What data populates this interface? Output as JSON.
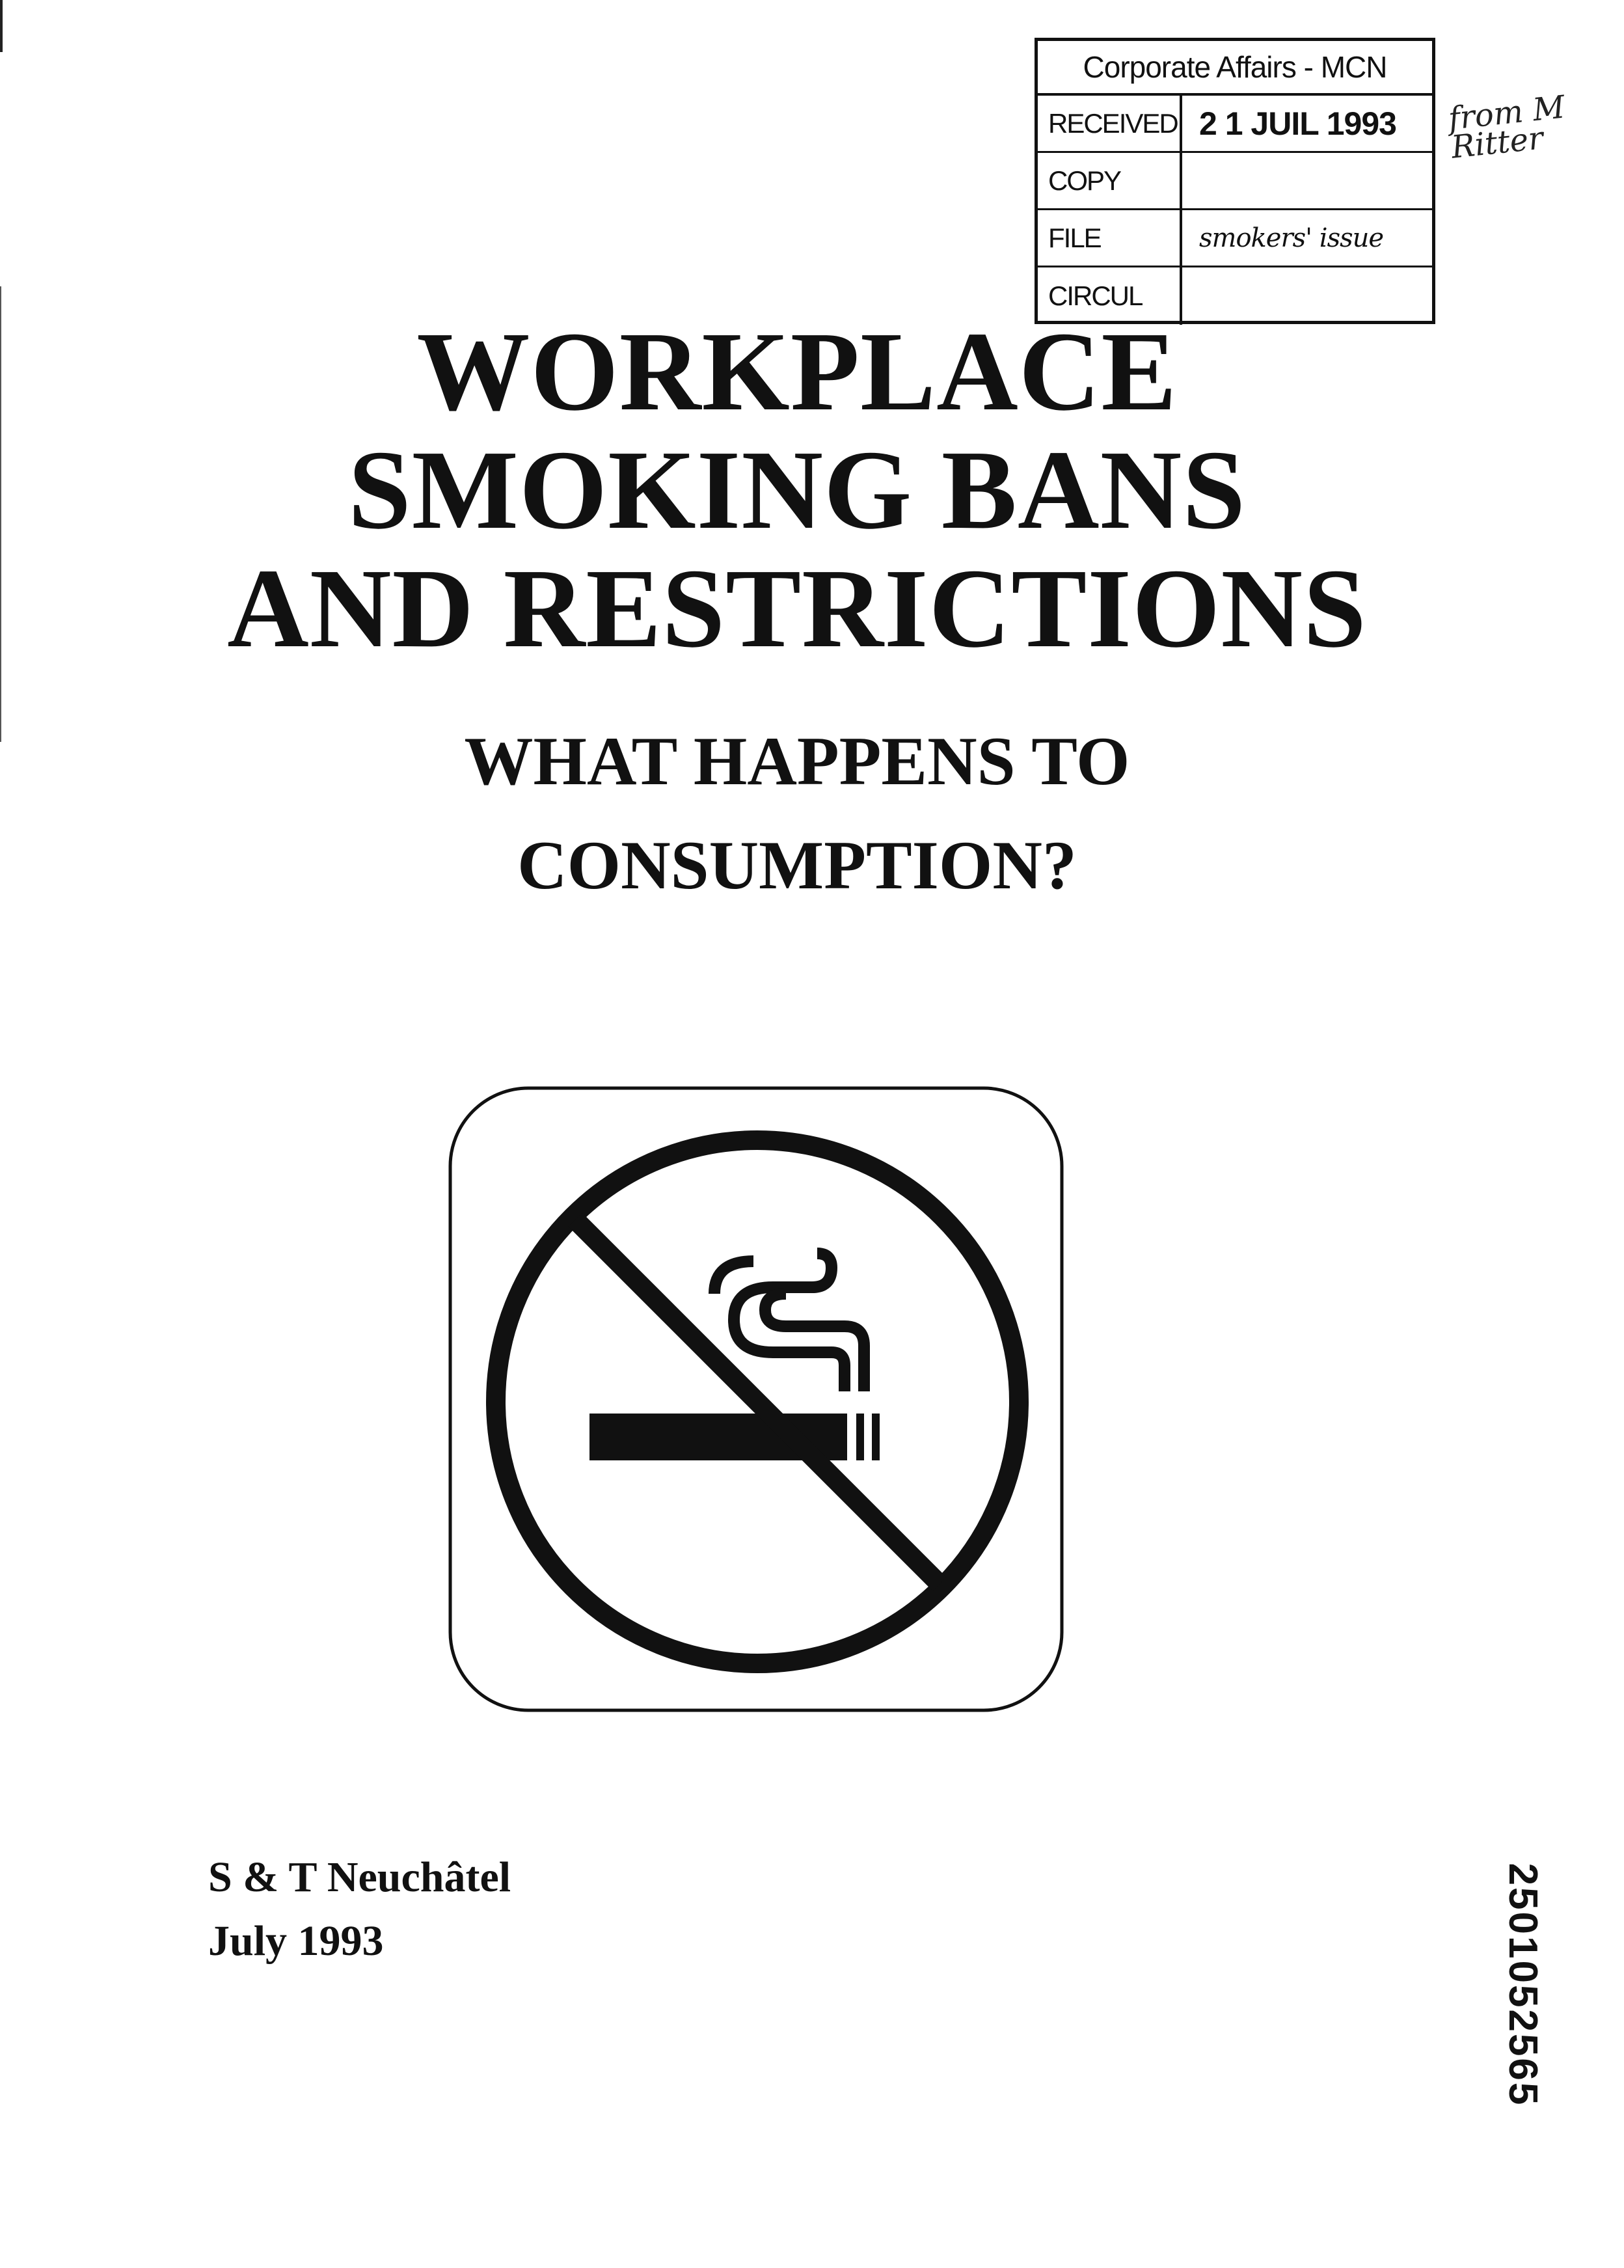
{
  "stamp": {
    "header": "Corporate Affairs - MCN",
    "rows": [
      {
        "label": "RECEIVED",
        "value": "2 1 JUIL 1993"
      },
      {
        "label": "COPY",
        "value": ""
      },
      {
        "label": "FILE",
        "value": "smokers' issue"
      },
      {
        "label": "CIRCUL",
        "value": ""
      }
    ],
    "handwritten_note": "from M Ritter"
  },
  "title": {
    "line1": "WORKPLACE",
    "line2": "SMOKING BANS",
    "line3": "AND RESTRICTIONS"
  },
  "subtitle": {
    "line1": "WHAT HAPPENS TO",
    "line2": "CONSUMPTION?"
  },
  "sign": {
    "icon": "no-smoking-icon",
    "color": "#111111"
  },
  "byline": {
    "author": "S & T Neuchâtel",
    "date": "July 1993"
  },
  "bates_number": "2501052565"
}
